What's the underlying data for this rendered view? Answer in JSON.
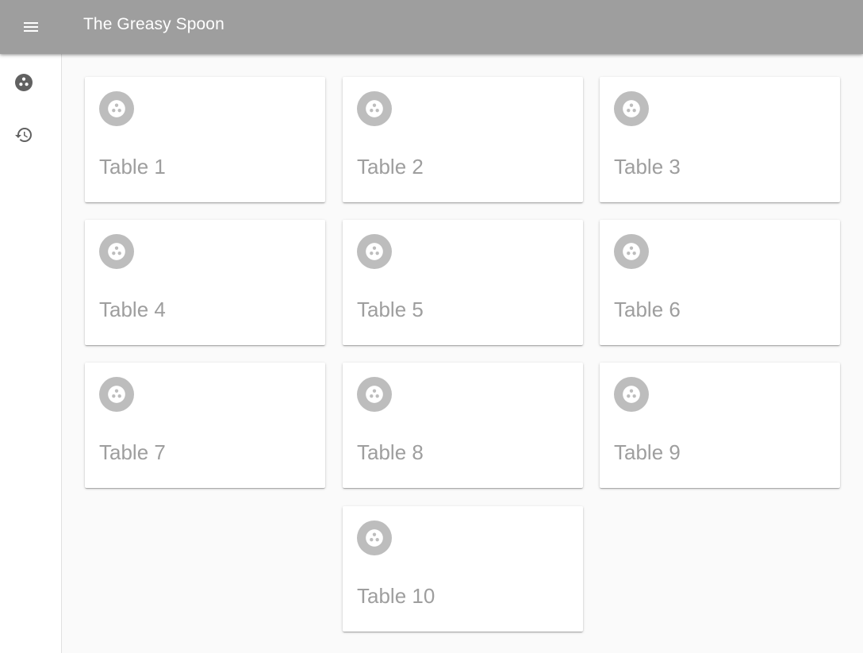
{
  "app": {
    "title": "The Greasy Spoon",
    "colors": {
      "appbar": "#9e9e9e",
      "avatar": "#bdbdbd",
      "label": "#9e9e9e",
      "nav_icon": "#616161"
    }
  },
  "appbar": {
    "menu_icon": "menu-icon"
  },
  "sidebar": {
    "items": [
      {
        "icon": "tables-icon",
        "active": true
      },
      {
        "icon": "history-icon",
        "active": false
      }
    ]
  },
  "tables": [
    {
      "label": "Table 1",
      "icon": "table-icon"
    },
    {
      "label": "Table 2",
      "icon": "table-icon"
    },
    {
      "label": "Table 3",
      "icon": "table-icon"
    },
    {
      "label": "Table 4",
      "icon": "table-icon"
    },
    {
      "label": "Table 5",
      "icon": "table-icon"
    },
    {
      "label": "Table 6",
      "icon": "table-icon"
    },
    {
      "label": "Table 7",
      "icon": "table-icon"
    },
    {
      "label": "Table 8",
      "icon": "table-icon"
    },
    {
      "label": "Table 9",
      "icon": "table-icon"
    },
    {
      "label": "Table 10",
      "icon": "table-icon"
    }
  ]
}
